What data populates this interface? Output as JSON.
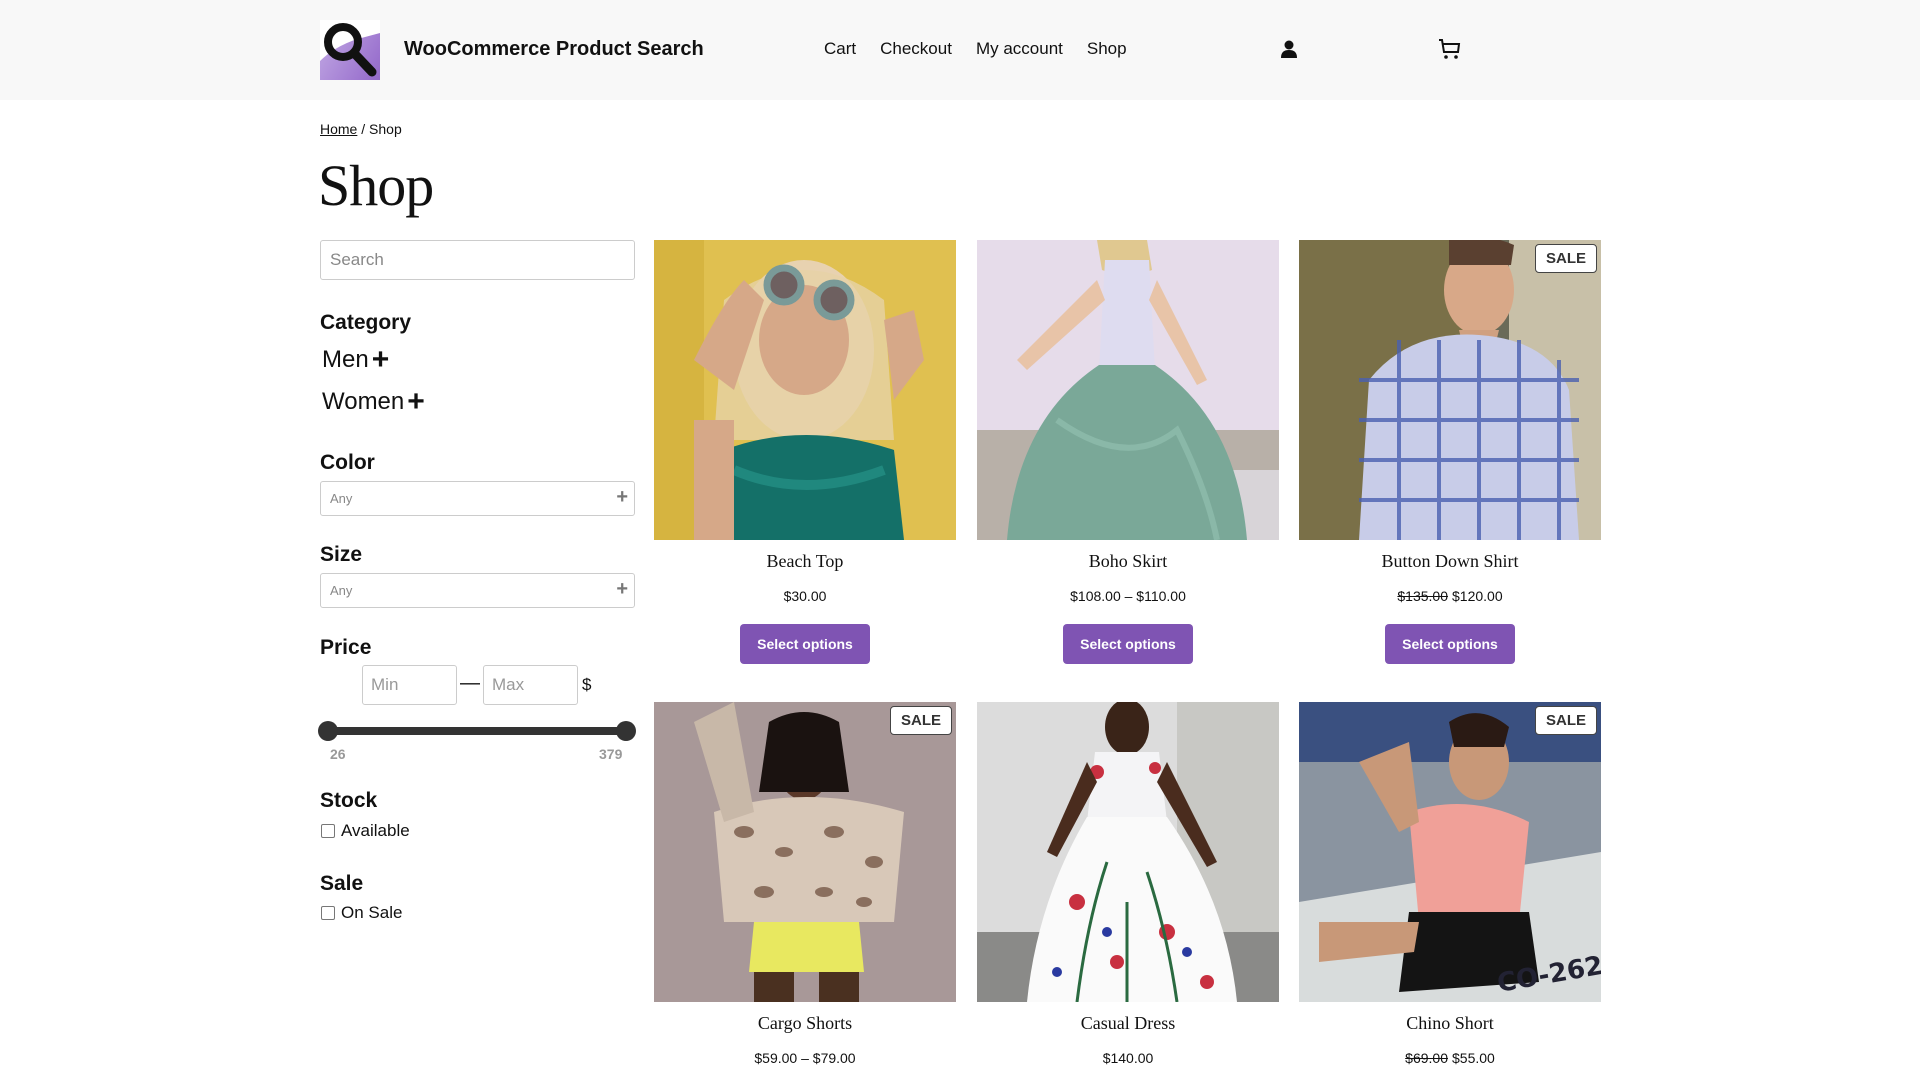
{
  "header": {
    "site_title": "WooCommerce Product Search",
    "nav": [
      "Cart",
      "Checkout",
      "My account",
      "Shop"
    ],
    "icons": {
      "logo": "magnifier-logo",
      "user": "user-icon",
      "cart": "cart-icon"
    }
  },
  "breadcrumb": {
    "home": "Home",
    "separator": " / ",
    "current": "Shop"
  },
  "page_title": "Shop",
  "sidebar": {
    "search_placeholder": "Search",
    "category": {
      "title": "Category",
      "items": [
        {
          "label": "Men",
          "toggle": "+"
        },
        {
          "label": "Women",
          "toggle": "+"
        }
      ]
    },
    "color": {
      "title": "Color",
      "placeholder": "Any",
      "toggle": "+"
    },
    "size": {
      "title": "Size",
      "placeholder": "Any",
      "toggle": "+"
    },
    "price": {
      "title": "Price",
      "min_placeholder": "Min",
      "max_placeholder": "Max",
      "dash": "—",
      "currency": "$",
      "range_min": "26",
      "range_max": "379"
    },
    "stock": {
      "title": "Stock",
      "option": "Available",
      "checked": false
    },
    "sale": {
      "title": "Sale",
      "option": "On Sale",
      "checked": false
    }
  },
  "colors": {
    "accent": "#7f54b3",
    "header_bg": "#f8f8f8"
  },
  "products": [
    {
      "name": "Beach Top",
      "price": "$30.00",
      "regular_price": "",
      "sale": false,
      "button": "Select options"
    },
    {
      "name": "Boho Skirt",
      "price": "$108.00 – $110.00",
      "regular_price": "",
      "sale": false,
      "button": "Select options"
    },
    {
      "name": "Button Down Shirt",
      "price": "$120.00",
      "regular_price": "$135.00",
      "sale": true,
      "sale_label": "SALE",
      "button": "Select options"
    },
    {
      "name": "Cargo Shorts",
      "price": "$59.00 – $79.00",
      "regular_price": "",
      "sale": true,
      "sale_label": "SALE"
    },
    {
      "name": "Casual Dress",
      "price": "$140.00",
      "regular_price": "",
      "sale": false
    },
    {
      "name": "Chino Short",
      "price": "$55.00",
      "regular_price": "$69.00",
      "sale": true,
      "sale_label": "SALE"
    }
  ]
}
